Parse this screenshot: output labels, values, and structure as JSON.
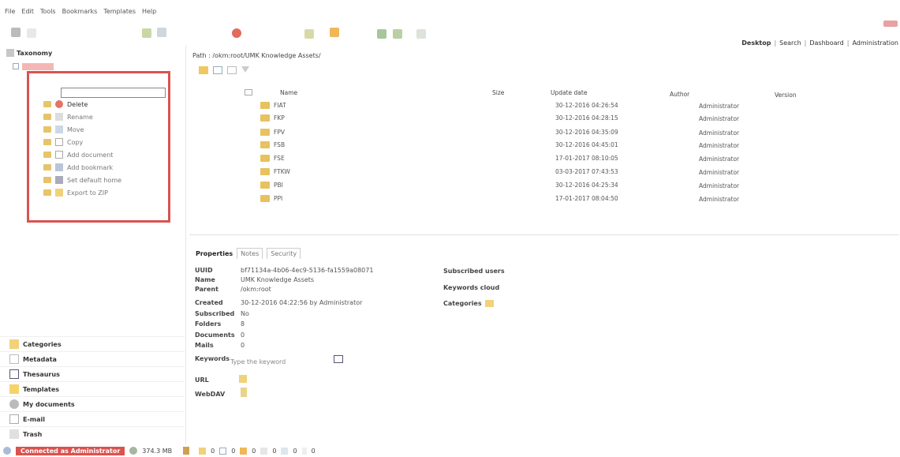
{
  "menu": [
    "File",
    "Edit",
    "Tools",
    "Bookmarks",
    "Templates",
    "Help"
  ],
  "tabs_right": [
    "Desktop",
    "Search",
    "Dashboard",
    "Administration"
  ],
  "sidebar": {
    "taxonomy_title": "Taxonomy",
    "context_menu": [
      "Delete",
      "Rename",
      "Move",
      "Copy",
      "Add document",
      "Add bookmark",
      "Set default home",
      "Export to ZIP"
    ],
    "bottom": [
      "Categories",
      "Metadata",
      "Thesaurus",
      "Templates",
      "My documents",
      "E-mail",
      "Trash"
    ]
  },
  "path": {
    "label": "Path :",
    "value": "/okm:root/UMK Knowledge Assets/"
  },
  "grid": {
    "headers": {
      "name": "Name",
      "size": "Size",
      "date": "Update date",
      "author": "Author",
      "version": "Version"
    },
    "rows": [
      {
        "name": "FIAT",
        "date": "30-12-2016 04:26:54",
        "author": "Administrator"
      },
      {
        "name": "FKP",
        "date": "30-12-2016 04:28:15",
        "author": "Administrator"
      },
      {
        "name": "FPV",
        "date": "30-12-2016 04:35:09",
        "author": "Administrator"
      },
      {
        "name": "FSB",
        "date": "30-12-2016 04:45:01",
        "author": "Administrator"
      },
      {
        "name": "FSE",
        "date": "17-01-2017 08:10:05",
        "author": "Administrator"
      },
      {
        "name": "FTKW",
        "date": "03-03-2017 07:43:53",
        "author": "Administrator"
      },
      {
        "name": "PBI",
        "date": "30-12-2016 04:25:34",
        "author": "Administrator"
      },
      {
        "name": "PPI",
        "date": "17-01-2017 08:04:50",
        "author": "Administrator"
      }
    ]
  },
  "props": {
    "tabs": [
      "Properties",
      "Notes",
      "Security"
    ],
    "fields": [
      {
        "label": "UUID",
        "value": "bf71134a-4b06-4ec9-5136-fa1559a08071"
      },
      {
        "label": "Name",
        "value": "UMK Knowledge Assets"
      },
      {
        "label": "Parent",
        "value": "/okm:root"
      },
      {
        "label": "Created",
        "value": "30-12-2016 04:22:56 by Administrator"
      },
      {
        "label": "Subscribed",
        "value": "No"
      },
      {
        "label": "Folders",
        "value": "8"
      },
      {
        "label": "Documents",
        "value": "0"
      },
      {
        "label": "Mails",
        "value": "0"
      }
    ],
    "keywords_label": "Keywords",
    "keywords_placeholder": "Type the keyword",
    "url_label": "URL",
    "webdav_label": "WebDAV",
    "right_labels": [
      "Subscribed users",
      "Keywords cloud",
      "Categories"
    ]
  },
  "status": {
    "connected": "Connected as Administrator",
    "size": "374.3 MB",
    "counters": [
      "0",
      "0",
      "0",
      "0",
      "0",
      "0"
    ]
  },
  "colors": {
    "accent_red": "#d9534f",
    "folder": "#e8c25f"
  }
}
